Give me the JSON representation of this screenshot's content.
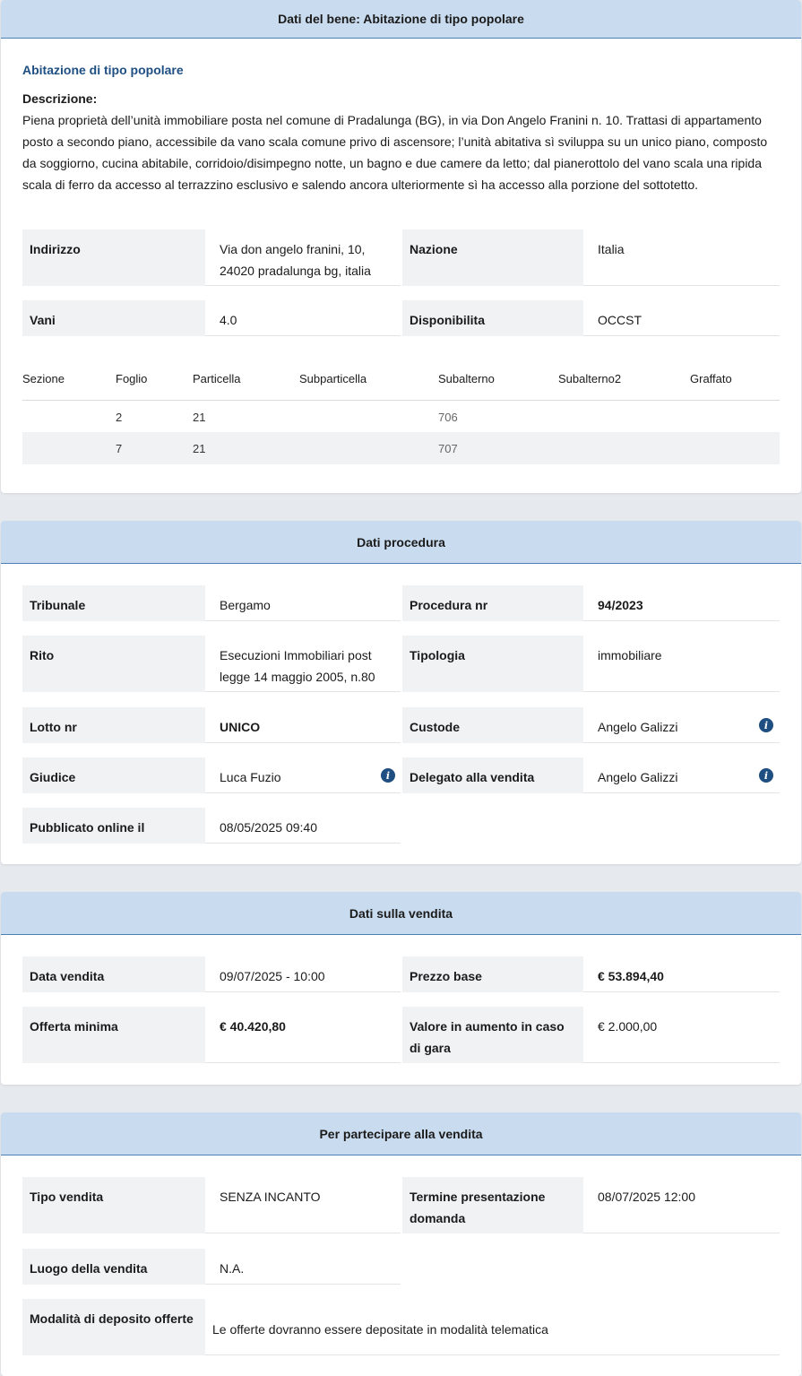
{
  "bene": {
    "header": "Dati del bene: Abitazione di tipo popolare",
    "subtitle": "Abitazione di tipo popolare",
    "descr_label": "Descrizione:",
    "descr_text": "Piena proprietà dell’unità immobiliare posta nel comune di Pradalunga (BG), in via Don Angelo Franini n. 10. Trattasi di appartamento posto a secondo piano, accessibile da vano scala comune privo di ascensore; l’unità abitativa sì sviluppa su un unico piano, composto da soggiorno, cucina abitabile, corridoio/disimpegno notte, un bagno e due camere da letto; dal pianerottolo del vano scala una ripida scala di ferro da accesso al terrazzino esclusivo e salendo ancora ulteriormente sì ha accesso alla porzione del sottotetto.",
    "indirizzo_label": "Indirizzo",
    "indirizzo_value": "Via don angelo franini, 10, 24020 pradalunga bg, italia",
    "nazione_label": "Nazione",
    "nazione_value": "Italia",
    "vani_label": "Vani",
    "vani_value": "4.0",
    "disponibilita_label": "Disponibilita",
    "disponibilita_value": "OCCST",
    "catasto": {
      "headers": [
        "Sezione",
        "Foglio",
        "Particella",
        "Subparticella",
        "Subalterno",
        "Subalterno2",
        "Graffato"
      ],
      "rows": [
        [
          "",
          "2",
          "21",
          "",
          "706",
          "",
          ""
        ],
        [
          "",
          "7",
          "21",
          "",
          "707",
          "",
          ""
        ]
      ]
    }
  },
  "procedura": {
    "header": "Dati procedura",
    "tribunale_label": "Tribunale",
    "tribunale_value": "Bergamo",
    "procedura_label": "Procedura nr",
    "procedura_value": "94/2023",
    "rito_label": "Rito",
    "rito_value": "Esecuzioni Immobiliari post legge 14 maggio 2005, n.80",
    "tipologia_label": "Tipologia",
    "tipologia_value": "immobiliare",
    "lotto_label": "Lotto nr",
    "lotto_value": "UNICO",
    "custode_label": "Custode",
    "custode_value": "Angelo Galizzi",
    "giudice_label": "Giudice",
    "giudice_value": "Luca Fuzio",
    "delegato_label": "Delegato alla vendita",
    "delegato_value": "Angelo Galizzi",
    "pubblicato_label": "Pubblicato online il",
    "pubblicato_value": "08/05/2025 09:40",
    "icon": "info-circle-icon"
  },
  "vendita": {
    "header": "Dati sulla vendita",
    "data_label": "Data vendita",
    "data_value": "09/07/2025 - 10:00",
    "prezzo_label": "Prezzo base",
    "prezzo_value": "€ 53.894,40",
    "offerta_label": "Offerta minima",
    "offerta_value": "€ 40.420,80",
    "aumento_label": "Valore in aumento in caso di gara",
    "aumento_value": "€ 2.000,00"
  },
  "partecipare": {
    "header": "Per partecipare alla vendita",
    "tipo_label": "Tipo vendita",
    "tipo_value": "SENZA INCANTO",
    "termine_label": "Termine presentazione domanda",
    "termine_value": "08/07/2025 12:00",
    "luogo_label": "Luogo della vendita",
    "luogo_value": "N.A.",
    "modalita_label": "Modalità di deposito offerte",
    "modalita_value": "Le offerte dovranno essere depositate in modalità telematica"
  },
  "colors": {
    "header_bg": "#c9dbee",
    "header_border": "#4f80b5",
    "subtitle": "#1f4f82",
    "label_bg": "#f1f2f4",
    "info_icon": "#1f4f82"
  }
}
